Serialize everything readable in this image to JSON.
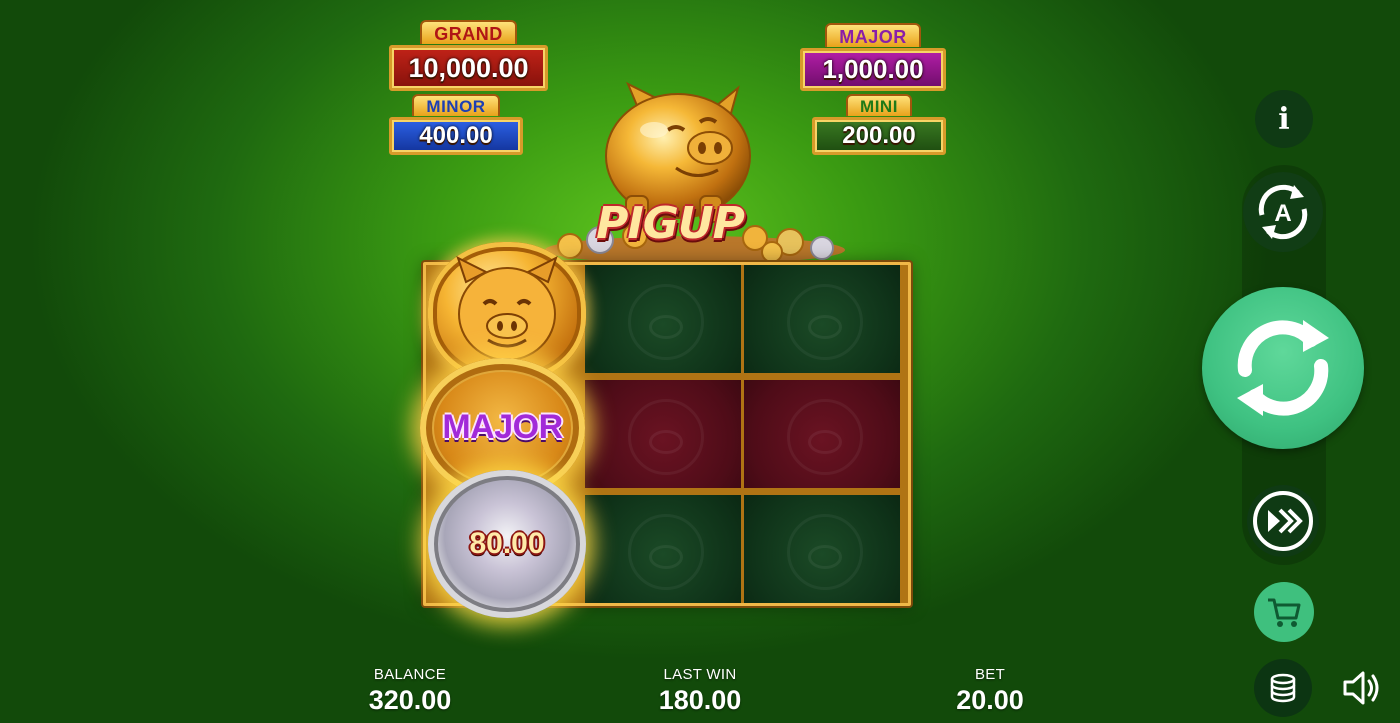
{
  "jackpots": {
    "grand": {
      "label": "GRAND",
      "value": "10,000.00"
    },
    "major": {
      "label": "MAJOR",
      "value": "1,000.00"
    },
    "minor": {
      "label": "MINOR",
      "value": "400.00"
    },
    "mini": {
      "label": "MINI",
      "value": "200.00"
    }
  },
  "logo": {
    "text": "PIGUP"
  },
  "reels": {
    "columns": 3,
    "rows": 3,
    "cell_colors": [
      [
        "coin",
        "green",
        "green"
      ],
      [
        "coin",
        "red",
        "red"
      ],
      [
        "coin",
        "green",
        "green"
      ]
    ],
    "symbols": {
      "top": "pig-coin",
      "middle": {
        "type": "jackpot-coin",
        "label": "MAJOR"
      },
      "bottom": {
        "type": "silver-coin",
        "label": "80.00"
      }
    }
  },
  "controls": {
    "info_label": "i",
    "autoplay_icon": "autoplay-icon",
    "spin_icon": "spin-arrows-icon",
    "turbo_icon": "fast-forward-icon",
    "shop_icon": "cart-icon",
    "bet_icon": "coin-stack-icon",
    "sound_icon": "speaker-icon"
  },
  "stats": {
    "balance": {
      "label": "BALANCE",
      "value": "320.00"
    },
    "last_win": {
      "label": "LAST WIN",
      "value": "180.00"
    },
    "bet": {
      "label": "BET",
      "value": "20.00"
    }
  },
  "colors": {
    "background": "#3a9a12",
    "spin_button": "#3fc282",
    "grid_frame": "#f0b848",
    "cell_green": "#0f3319",
    "cell_red": "#4f0c18"
  }
}
